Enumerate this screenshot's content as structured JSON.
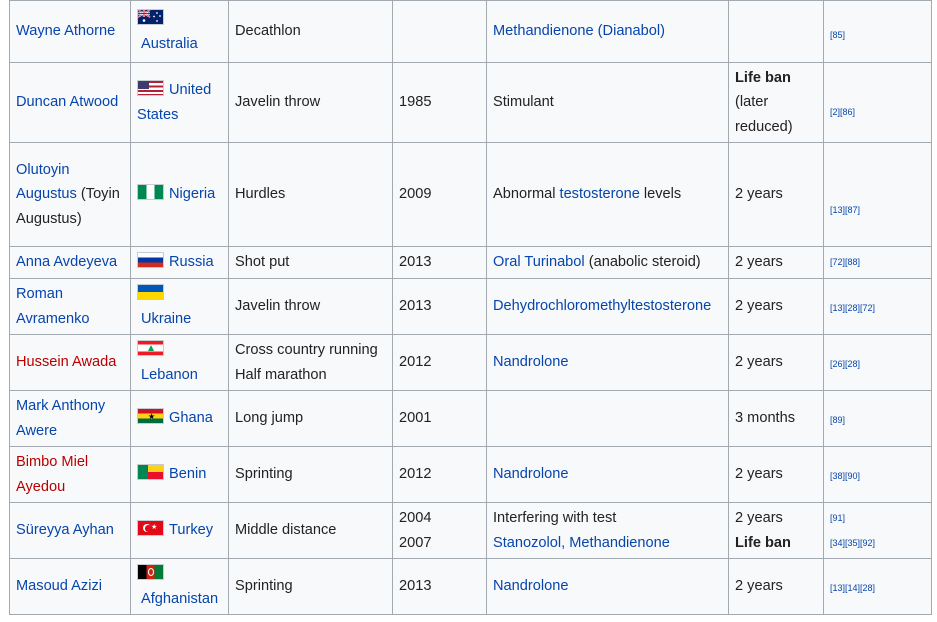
{
  "rows": [
    {
      "athlete": "Wayne Athorne",
      "athlete_link": "blue",
      "country": "Australia",
      "flag": "australia-flag-icon",
      "event": "Decathlon",
      "year": "",
      "substance": [
        {
          "t": "Methandienone (Dianabol)",
          "link": true
        }
      ],
      "sanction": "",
      "sanction_bold": false,
      "refs": [
        "[85]"
      ]
    },
    {
      "athlete": "Duncan Atwood",
      "athlete_link": "blue",
      "country": "United States",
      "flag": "united-states-flag-icon",
      "event": "Javelin throw",
      "year": "1985",
      "substance": [
        {
          "t": "Stimulant",
          "link": false
        }
      ],
      "sanction": "Life ban",
      "sanction_extra": "(later reduced)",
      "sanction_bold": true,
      "refs": [
        "[2][86]"
      ]
    },
    {
      "athlete": "Olutoyin Augustus (Toyin Augustus)",
      "athlete_link": "mixed",
      "country": "Nigeria",
      "flag": "nigeria-flag-icon",
      "event": "Hurdles",
      "year": "2009",
      "substance": [
        {
          "t": "Abnormal ",
          "link": false
        },
        {
          "t": "testosterone",
          "link": true
        },
        {
          "t": " levels",
          "link": false
        }
      ],
      "sanction": "2 years",
      "sanction_bold": false,
      "refs": [
        "[13][87]"
      ]
    },
    {
      "athlete": "Anna Avdeyeva",
      "athlete_link": "blue",
      "country": "Russia",
      "flag": "russia-flag-icon",
      "event": "Shot put",
      "year": "2013",
      "substance": [
        {
          "t": "Oral Turinabol",
          "link": true
        },
        {
          "t": " (anabolic steroid)",
          "link": false
        }
      ],
      "sanction": "2 years",
      "sanction_bold": false,
      "refs": [
        "[72][88]"
      ]
    },
    {
      "athlete": "Roman Avramenko",
      "athlete_link": "blue",
      "country": "Ukraine",
      "flag": "ukraine-flag-icon",
      "event": "Javelin throw",
      "year": "2013",
      "substance": [
        {
          "t": "Dehydrochloromethyltestosterone",
          "link": true
        }
      ],
      "sanction": "2 years",
      "sanction_bold": false,
      "refs": [
        "[13][28][72]"
      ]
    },
    {
      "athlete": "Hussein Awada",
      "athlete_link": "red",
      "country": "Lebanon",
      "flag": "lebanon-flag-icon",
      "event": "Cross country running Half marathon",
      "year": "2012",
      "substance": [
        {
          "t": "Nandrolone",
          "link": true
        }
      ],
      "sanction": "2 years",
      "sanction_bold": false,
      "refs": [
        "[26][28]"
      ]
    },
    {
      "athlete": "Mark Anthony Awere",
      "athlete_link": "blue",
      "country": "Ghana",
      "flag": "ghana-flag-icon",
      "event": "Long jump",
      "year": "2001",
      "substance": [],
      "sanction": "3 months",
      "sanction_bold": false,
      "refs": [
        "[89]"
      ]
    },
    {
      "athlete": "Bimbo Miel Ayedou",
      "athlete_link": "red",
      "country": "Benin",
      "flag": "benin-flag-icon",
      "event": "Sprinting",
      "year": "2012",
      "substance": [
        {
          "t": "Nandrolone",
          "link": true
        }
      ],
      "sanction": "2 years",
      "sanction_bold": false,
      "refs": [
        "[38][90]"
      ]
    },
    {
      "athlete": "Süreyya Ayhan",
      "athlete_link": "blue",
      "country": "Turkey",
      "flag": "turkey-flag-icon",
      "event": "Middle distance",
      "year": "2004",
      "year2": "2007",
      "substance": [
        {
          "t": "Interfering with test",
          "link": false
        }
      ],
      "substance2": "Stanozolol, Methandienone",
      "sanction": "2 years",
      "sanction2": "Life ban",
      "sanction_bold": false,
      "refs": [
        "[91]",
        "[34][35][92]"
      ]
    },
    {
      "athlete": "Masoud Azizi",
      "athlete_link": "blue",
      "country": "Afghanistan",
      "flag": "afghanistan-flag-icon",
      "event": "Sprinting",
      "year": "2013",
      "substance": [
        {
          "t": "Nandrolone",
          "link": true
        }
      ],
      "sanction": "2 years",
      "sanction_bold": false,
      "refs": [
        "[13][14][28]"
      ]
    }
  ],
  "colors": {
    "link": "#0645ad",
    "redlink": "#ba0000",
    "border": "#a2a9b1",
    "cell_bg": "#f8f9fa"
  }
}
